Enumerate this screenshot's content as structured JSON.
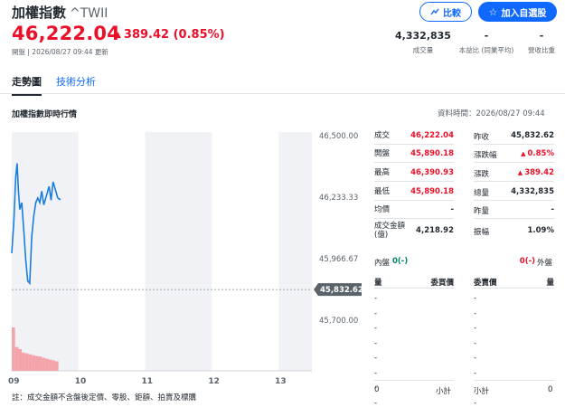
{
  "header": {
    "title": "加權指數",
    "symbol": "^TWII",
    "price": "46,222.04",
    "change": "389.42 (0.85%)",
    "change_arrow": "▲",
    "meta": "開盤 | 2026/08/27 09:44 更新"
  },
  "buttons": {
    "compare": "比較",
    "watchlist": "加入自選股"
  },
  "stats": [
    {
      "value": "4,332,835",
      "label": "成交量"
    },
    {
      "value": "-",
      "label": "本益比 (同業平均)"
    },
    {
      "value": "-",
      "label": "營收比重"
    }
  ],
  "tabs": [
    {
      "label": "走勢圖",
      "active": true
    },
    {
      "label": "技術分析",
      "active": false
    }
  ],
  "section": {
    "title": "加權指數即時行情",
    "data_time": "資料時間：2026/08/27 09:44"
  },
  "chart_data": {
    "type": "line",
    "y_ticks": [
      "46,500.00",
      "46,233.33",
      "45,966.67",
      "45,700.00"
    ],
    "x_ticks": [
      "09",
      "10",
      "11",
      "12",
      "13"
    ],
    "prev_close_label": "45,832.62",
    "ylim": [
      45700,
      46500
    ],
    "xlim": [
      9.0,
      13.5
    ],
    "prev_close": 45832.62,
    "series": [
      {
        "x": [
          9.0,
          9.03,
          9.06,
          9.08,
          9.1,
          9.12,
          9.15,
          9.18,
          9.21,
          9.24,
          9.27,
          9.3,
          9.33,
          9.36,
          9.39,
          9.42,
          9.45,
          9.48,
          9.52,
          9.56,
          9.59,
          9.62,
          9.65,
          9.69,
          9.73
        ],
        "y": [
          45990,
          46120,
          46320,
          46380,
          46260,
          46180,
          46210,
          46090,
          45960,
          45870,
          45860,
          46060,
          46150,
          46210,
          46230,
          46210,
          46260,
          46200,
          46240,
          46280,
          46220,
          46300,
          46270,
          46230,
          46222
        ]
      }
    ],
    "volume": {
      "x": [
        9.0,
        9.05,
        9.1,
        9.15,
        9.2,
        9.25,
        9.3,
        9.35,
        9.4,
        9.45,
        9.5,
        9.55,
        9.6,
        9.65,
        9.7
      ],
      "v": [
        1.0,
        0.55,
        0.5,
        0.42,
        0.4,
        0.38,
        0.36,
        0.34,
        0.33,
        0.3,
        0.28,
        0.26,
        0.24,
        0.22,
        0.2
      ]
    }
  },
  "quote": {
    "left": [
      {
        "label": "成交",
        "value": "46,222.04",
        "color": "red"
      },
      {
        "label": "開盤",
        "value": "45,890.18",
        "color": "red"
      },
      {
        "label": "最高",
        "value": "46,390.93",
        "color": "red"
      },
      {
        "label": "最低",
        "value": "45,890.18",
        "color": "red"
      },
      {
        "label": "均價",
        "value": "-",
        "color": "plain"
      },
      {
        "label": "成交金額(億)",
        "value": "4,218.92",
        "color": "plain"
      }
    ],
    "right": [
      {
        "label": "昨收",
        "value": "45,832.62",
        "color": "plain"
      },
      {
        "label": "漲跌幅",
        "value": "0.85%",
        "color": "red",
        "arrow": "▲"
      },
      {
        "label": "漲跌",
        "value": "389.42",
        "color": "red",
        "arrow": "▲"
      },
      {
        "label": "總量",
        "value": "4,332,835",
        "color": "plain"
      },
      {
        "label": "昨量",
        "value": "-",
        "color": "plain"
      },
      {
        "label": "振幅",
        "value": "1.09%",
        "color": "plain"
      }
    ],
    "inner_label": "內盤",
    "inner_value": "0(-)",
    "outer_label": "外盤",
    "outer_value": "0(-)",
    "book_headers": [
      "量",
      "委買價",
      "委賣價",
      "量"
    ],
    "book_rows": [
      "-",
      "-",
      "-",
      "-",
      "-",
      "-",
      "-",
      "-"
    ],
    "footer": {
      "left_vol": "0",
      "left_label": "小計",
      "right_label": "小計",
      "right_vol": "0"
    }
  },
  "note": "註：成交金額不含盤後定價、零股、鉅額、拍賣及標購"
}
